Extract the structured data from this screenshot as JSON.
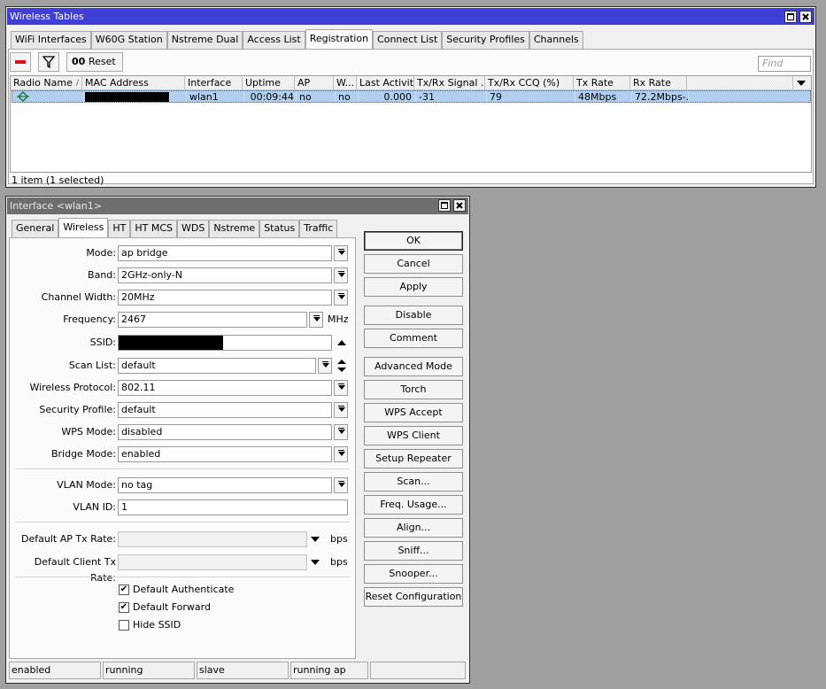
{
  "wireless_tables": {
    "title": "Wireless Tables",
    "tabs": [
      "WiFi Interfaces",
      "W60G Station",
      "Nstreme Dual",
      "Access List",
      "Registration",
      "Connect List",
      "Security Profiles",
      "Channels"
    ],
    "selected_tab": "Registration",
    "toolbar": {
      "reset_label": "Reset",
      "reset_icon_text": "00",
      "find_placeholder": "Find"
    },
    "columns": [
      "Radio Name",
      "MAC Address",
      "Interface",
      "Uptime",
      "AP",
      "W...",
      "Last Activit...",
      "Tx/Rx Signal ...",
      "Tx/Rx CCQ (%)",
      "Tx Rate",
      "Rx Rate"
    ],
    "sort_indicator": "/",
    "row": {
      "interface": "wlan1",
      "uptime": "00:09:44",
      "ap": "no",
      "w": "no",
      "last_activity": "0.000",
      "signal": "-31",
      "ccq": "79",
      "tx_rate": "48Mbps",
      "rx_rate": "72.2Mbps-..."
    },
    "status": "1 item (1 selected)"
  },
  "interface_window": {
    "title": "Interface <wlan1>",
    "tabs": [
      "General",
      "Wireless",
      "HT",
      "HT MCS",
      "WDS",
      "Nstreme",
      "Status",
      "Traffic"
    ],
    "selected_tab": "Wireless",
    "fields": {
      "mode": {
        "label": "Mode:",
        "value": "ap bridge"
      },
      "band": {
        "label": "Band:",
        "value": "2GHz-only-N"
      },
      "channel_width": {
        "label": "Channel Width:",
        "value": "20MHz"
      },
      "frequency": {
        "label": "Frequency:",
        "value": "2467",
        "unit": "MHz"
      },
      "ssid": {
        "label": "SSID:"
      },
      "scan_list": {
        "label": "Scan List:",
        "value": "default"
      },
      "wireless_protocol": {
        "label": "Wireless Protocol:",
        "value": "802.11"
      },
      "security_profile": {
        "label": "Security Profile:",
        "value": "default"
      },
      "wps_mode": {
        "label": "WPS Mode:",
        "value": "disabled"
      },
      "bridge_mode": {
        "label": "Bridge Mode:",
        "value": "enabled"
      },
      "vlan_mode": {
        "label": "VLAN Mode:",
        "value": "no tag"
      },
      "vlan_id": {
        "label": "VLAN ID:",
        "value": "1"
      },
      "default_ap_tx_rate": {
        "label": "Default AP Tx Rate:",
        "value": "",
        "unit": "bps"
      },
      "default_client_tx_rate": {
        "label": "Default Client Tx Rate:",
        "value": "",
        "unit": "bps"
      }
    },
    "checkboxes": {
      "default_authenticate": {
        "label": "Default Authenticate",
        "checked": true
      },
      "default_forward": {
        "label": "Default Forward",
        "checked": true
      },
      "hide_ssid": {
        "label": "Hide SSID",
        "checked": false
      }
    },
    "check_mark": "✔",
    "buttons": {
      "ok": "OK",
      "cancel": "Cancel",
      "apply": "Apply",
      "disable": "Disable",
      "comment": "Comment",
      "advanced_mode": "Advanced Mode",
      "torch": "Torch",
      "wps_accept": "WPS Accept",
      "wps_client": "WPS Client",
      "setup_repeater": "Setup Repeater",
      "scan": "Scan...",
      "freq_usage": "Freq. Usage...",
      "align": "Align...",
      "sniff": "Sniff...",
      "snooper": "Snooper...",
      "reset_configuration": "Reset Configuration"
    },
    "status": [
      "enabled",
      "running",
      "slave",
      "running ap",
      ""
    ]
  },
  "colors": {
    "active_title": "#3f3fd8",
    "inactive_title": "#6e6e6e",
    "selection": "#b3cff0",
    "desktop": "#a0a0a0"
  }
}
